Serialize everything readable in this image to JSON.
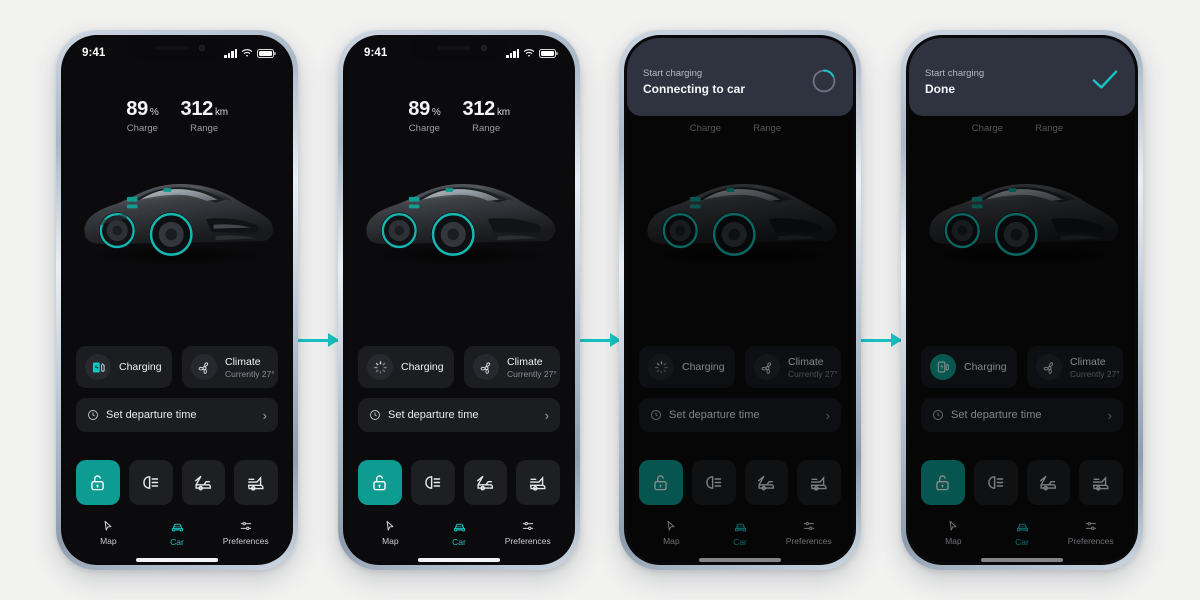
{
  "page": {
    "background_color": "#f2f2f1",
    "accent_color": "#17c4c4",
    "accent_solid": "#0f9e94",
    "screen_bg": "#0b0b0d",
    "tile_bg": "#1b1d21",
    "banner_bg": "#2f3340"
  },
  "status_bar": {
    "time": "9:41",
    "icons": [
      "cellular-signal-icon",
      "wifi-icon",
      "battery-icon"
    ]
  },
  "stats": {
    "charge": {
      "value": "89",
      "unit": "%",
      "label": "Charge"
    },
    "range": {
      "value": "312",
      "unit": "km",
      "label": "Range"
    }
  },
  "tiles": {
    "charging": {
      "label": "Charging",
      "sub": ""
    },
    "climate": {
      "label": "Climate",
      "sub": "Currently 27°"
    }
  },
  "departure": {
    "label": "Set departure time",
    "chevron": "›"
  },
  "quick_actions": [
    {
      "name": "unlock",
      "icon": "padlock-open-icon",
      "active": true
    },
    {
      "name": "headlights",
      "icon": "headlight-beam-icon",
      "active": false
    },
    {
      "name": "hood",
      "icon": "car-hood-open-icon",
      "active": false
    },
    {
      "name": "trunk",
      "icon": "car-trunk-open-icon",
      "active": false
    }
  ],
  "tabs": [
    {
      "label": "Map",
      "icon": "navigation-arrow-icon",
      "active": false
    },
    {
      "label": "Car",
      "icon": "car-icon",
      "active": true
    },
    {
      "label": "Preferences",
      "icon": "sliders-icon",
      "active": false
    }
  ],
  "frames": [
    {
      "id": "frame-1",
      "charging_icon": "ev-charger-icon",
      "charging_icon_state": "idle-teal-glyph",
      "banner": null,
      "dimmed": false
    },
    {
      "id": "frame-2",
      "charging_icon": "loading-spinner-icon",
      "charging_icon_state": "loading",
      "banner": null,
      "dimmed": false
    },
    {
      "id": "frame-3",
      "charging_icon": "loading-spinner-icon",
      "charging_icon_state": "loading",
      "banner": {
        "title": "Start charging",
        "status": "Connecting to car",
        "indicator": "progress-ring-icon"
      },
      "dimmed": true
    },
    {
      "id": "frame-4",
      "charging_icon": "ev-charger-icon",
      "charging_icon_state": "active-filled",
      "banner": {
        "title": "Start charging",
        "status": "Done",
        "indicator": "checkmark-icon"
      },
      "dimmed": true
    }
  ],
  "connectors": [
    {
      "name": "flow-arrow-1",
      "direction": "right"
    },
    {
      "name": "flow-arrow-2",
      "direction": "right"
    },
    {
      "name": "flow-arrow-3",
      "direction": "right"
    }
  ]
}
